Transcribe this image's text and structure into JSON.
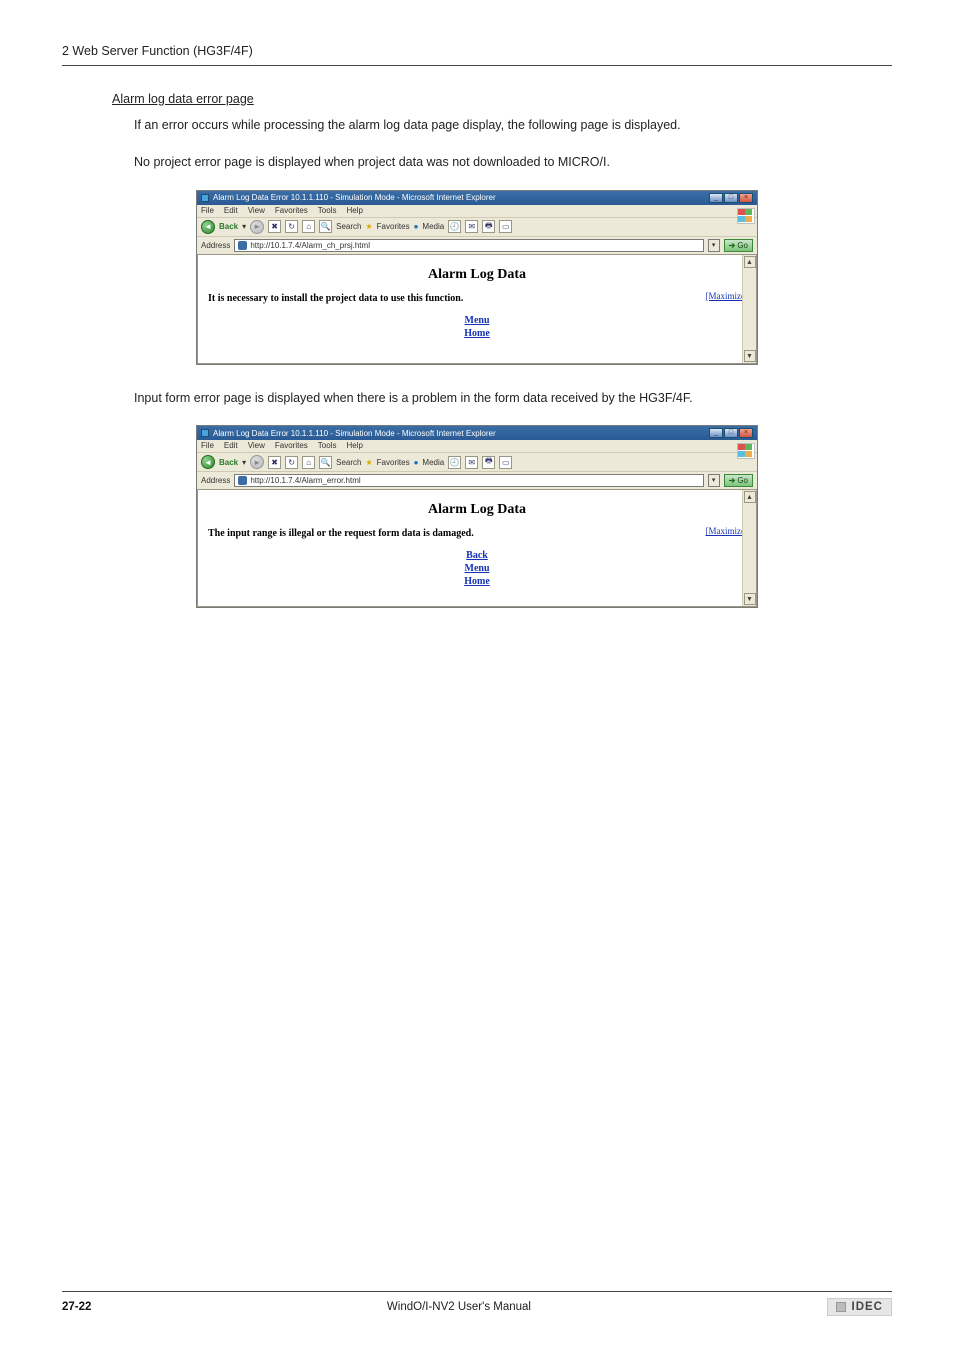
{
  "page_header": "2 Web Server Function (HG3F/4F)",
  "section_title": "Alarm log data error page",
  "para1": "If an error occurs while processing the alarm log data page display, the following page is displayed.",
  "para2": "No project error page is displayed when project data was not downloaded to MICRO/I.",
  "para3": "Input form error page is displayed when there is a problem in the form data received by the HG3F/4F.",
  "browser": {
    "title1": "Alarm Log Data Error 10.1.1.110 - Simulation Mode - Microsoft Internet Explorer",
    "title2": "Alarm Log Data Error 10.1.1.110 - Simulation Mode - Microsoft Internet Explorer",
    "menu": {
      "file": "File",
      "edit": "Edit",
      "view": "View",
      "favorites": "Favorites",
      "tools": "Tools",
      "help": "Help"
    },
    "toolbar": {
      "back": "Back",
      "search": "Search",
      "favorites": "Favorites",
      "media": "Media"
    },
    "address_label": "Address",
    "address1": "http://10.1.7.4/Alarm_ch_prsj.html",
    "address2": "http://10.1.7.4/Alarm_error.html",
    "go": "Go",
    "content_title": "Alarm Log Data",
    "msg1": "It is necessary to install the project data to use this function.",
    "msg2": "The input range is illegal or the request form data is damaged.",
    "maximize": "[Maximize]",
    "links": {
      "back": "Back",
      "menu": "Menu",
      "home": "Home"
    }
  },
  "footer": {
    "page": "27-22",
    "center": "WindO/I-NV2 User's Manual",
    "brand": "IDEC"
  }
}
